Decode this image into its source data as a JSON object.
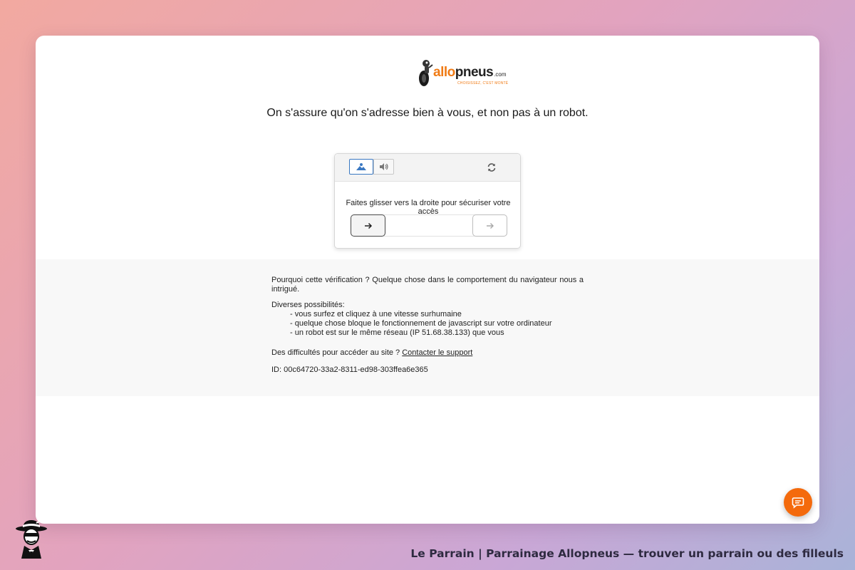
{
  "logo": {
    "brand_part1": "allo",
    "brand_part2": "pneus",
    "brand_suffix": ".com",
    "tagline": "CHOISISSEZ, C'EST MONTÉ",
    "accent_color": "#f07b15"
  },
  "headline": "On s'assure qu'on s'adresse bien à vous, et non pas à un robot.",
  "captcha": {
    "mode_image_icon": "image-icon",
    "mode_audio_icon": "speaker-icon",
    "refresh_icon": "refresh-icon",
    "instruction": "Faites glisser vers la droite pour sécuriser votre accès",
    "handle_icon": "arrow-right-icon",
    "target_icon": "arrow-right-icon",
    "active_color": "#3a78c2"
  },
  "info": {
    "why": "Pourquoi cette vérification ? Quelque chose dans le comportement du navigateur nous a intrigué.",
    "possibilities_title": "Diverses possibilités:",
    "possibilities": [
      "- vous surfez et cliquez à une vitesse surhumaine",
      "- quelque chose bloque le fonctionnement de javascript sur votre ordinateur",
      "- un robot est sur le même réseau (IP 51.68.38.133) que vous"
    ],
    "help_prefix": "Des difficultés pour accéder au site ? ",
    "help_link": "Contacter le support",
    "id_line": "ID: 00c64720-33a2-8311-ed98-303ffea6e365"
  },
  "chat": {
    "icon": "chat-icon",
    "color": "#f46a0c"
  },
  "footer": {
    "mascot_icon": "godfather-mascot-icon",
    "title": "Le Parrain | Parrainage Allopneus — trouver un parrain ou des filleuls"
  }
}
